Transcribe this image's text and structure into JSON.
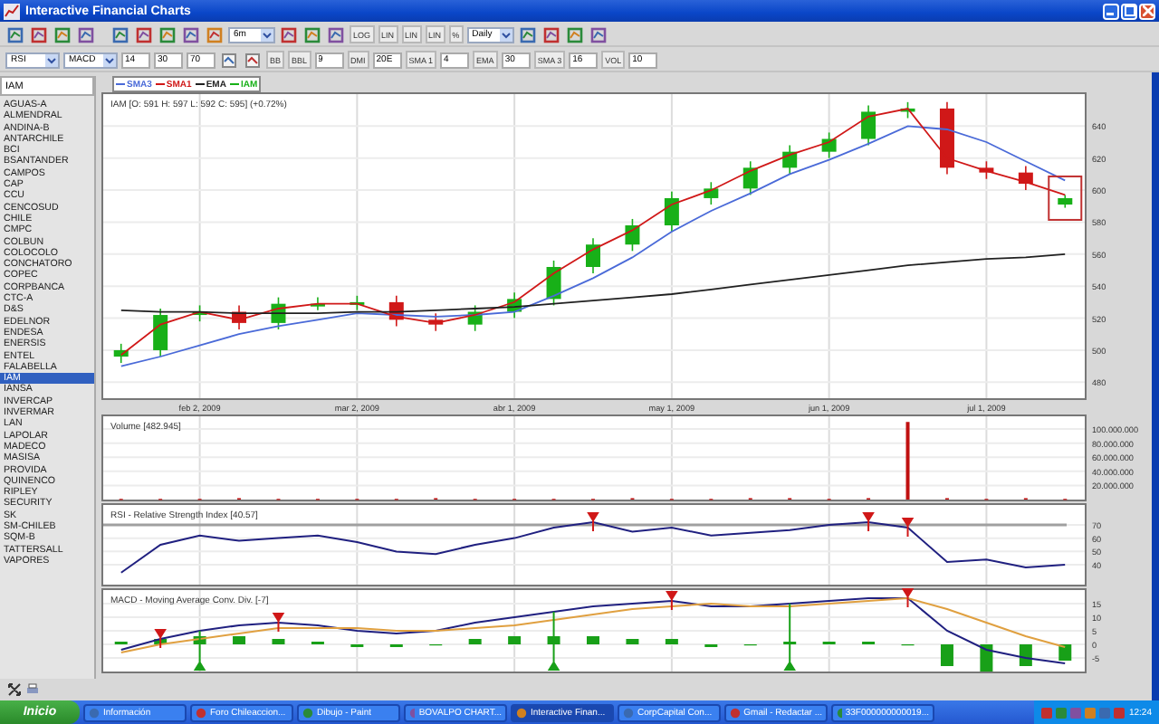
{
  "window": {
    "title": "Interactive Financial Charts"
  },
  "toolbar_1": [
    {
      "kind": "icon"
    },
    {
      "kind": "icon"
    },
    {
      "kind": "icon"
    },
    {
      "kind": "icon"
    },
    {
      "kind": "gap"
    },
    {
      "kind": "icon"
    },
    {
      "kind": "icon"
    },
    {
      "kind": "icon"
    },
    {
      "kind": "icon"
    },
    {
      "kind": "icon"
    },
    {
      "kind": "select",
      "value": "6m"
    },
    {
      "kind": "icon"
    },
    {
      "kind": "icon"
    },
    {
      "kind": "icon"
    },
    {
      "kind": "label",
      "text": "LOG"
    },
    {
      "kind": "label",
      "text": "LIN"
    },
    {
      "kind": "label",
      "text": "LIN"
    },
    {
      "kind": "label",
      "text": "LIN"
    },
    {
      "kind": "label",
      "text": "%"
    },
    {
      "kind": "select",
      "value": "Daily"
    },
    {
      "kind": "icon"
    },
    {
      "kind": "icon"
    },
    {
      "kind": "icon"
    },
    {
      "kind": "icon"
    }
  ],
  "toolbar_2": [
    {
      "kind": "select",
      "value": "RSI"
    },
    {
      "kind": "select",
      "value": "MACD"
    },
    {
      "kind": "field",
      "value": "14"
    },
    {
      "kind": "field",
      "value": "30"
    },
    {
      "kind": "field",
      "value": "70"
    },
    {
      "kind": "icon"
    },
    {
      "kind": "icon"
    },
    {
      "kind": "label",
      "text": "BB"
    },
    {
      "kind": "label",
      "text": "BBL"
    },
    {
      "kind": "field",
      "value": "9"
    },
    {
      "kind": "label",
      "text": "DMI"
    },
    {
      "kind": "field",
      "value": "20E"
    },
    {
      "kind": "label",
      "text": "SMA 1"
    },
    {
      "kind": "field",
      "value": "4"
    },
    {
      "kind": "label",
      "text": "EMA"
    },
    {
      "kind": "field",
      "value": "30"
    },
    {
      "kind": "label",
      "text": "SMA 3"
    },
    {
      "kind": "field",
      "value": "16"
    },
    {
      "kind": "label",
      "text": "VOL"
    },
    {
      "kind": "field",
      "value": "10"
    }
  ],
  "symbol_field": {
    "value": "IAM"
  },
  "symbols": [
    {
      "label": "AGUAS-A",
      "selected": false
    },
    {
      "label": "ALMENDRAL",
      "selected": false
    },
    {
      "label": "ANDINA-B",
      "selected": false
    },
    {
      "label": "ANTARCHILE",
      "selected": false
    },
    {
      "label": "BCI",
      "selected": false
    },
    {
      "label": "BSANTANDER",
      "selected": false
    },
    {
      "label": "CAMPOS",
      "selected": false
    },
    {
      "label": "CAP",
      "selected": false
    },
    {
      "label": "CCU",
      "selected": false
    },
    {
      "label": "CENCOSUD",
      "selected": false
    },
    {
      "label": "CHILE",
      "selected": false
    },
    {
      "label": "CMPC",
      "selected": false
    },
    {
      "label": "COLBUN",
      "selected": false
    },
    {
      "label": "COLOCOLO",
      "selected": false
    },
    {
      "label": "CONCHATORO",
      "selected": false
    },
    {
      "label": "COPEC",
      "selected": false
    },
    {
      "label": "CORPBANCA",
      "selected": false
    },
    {
      "label": "CTC-A",
      "selected": false
    },
    {
      "label": "D&S",
      "selected": false
    },
    {
      "label": "EDELNOR",
      "selected": false
    },
    {
      "label": "ENDESA",
      "selected": false
    },
    {
      "label": "ENERSIS",
      "selected": false
    },
    {
      "label": "ENTEL",
      "selected": false
    },
    {
      "label": "FALABELLA",
      "selected": false
    },
    {
      "label": "IAM",
      "selected": true
    },
    {
      "label": "IANSA",
      "selected": false
    },
    {
      "label": "INVERCAP",
      "selected": false
    },
    {
      "label": "INVERMAR",
      "selected": false
    },
    {
      "label": "LAN",
      "selected": false
    },
    {
      "label": "LAPOLAR",
      "selected": false
    },
    {
      "label": "MADECO",
      "selected": false
    },
    {
      "label": "MASISA",
      "selected": false
    },
    {
      "label": "PROVIDA",
      "selected": false
    },
    {
      "label": "QUINENCO",
      "selected": false
    },
    {
      "label": "RIPLEY",
      "selected": false
    },
    {
      "label": "SECURITY",
      "selected": false
    },
    {
      "label": "SK",
      "selected": false
    },
    {
      "label": "SM-CHILEB",
      "selected": false
    },
    {
      "label": "SQM-B",
      "selected": false
    },
    {
      "label": "TATTERSALL",
      "selected": false
    },
    {
      "label": "VAPORES",
      "selected": false
    }
  ],
  "charts": [
    {
      "chart_data": {
        "type": "candlestick",
        "title": "IAM [O: 591  H: 597  L: 592  C: 595] (+0.72%)",
        "grid": true,
        "categories": [
          null,
          null,
          "feb 2, 2009",
          null,
          null,
          null,
          "mar 2, 2009",
          null,
          null,
          null,
          "abr 1, 2009",
          null,
          null,
          null,
          "may 1, 2009",
          null,
          null,
          null,
          "jun 1, 2009",
          null,
          null,
          null,
          "jul 1, 2009",
          null,
          null
        ],
        "ylim": [
          470,
          660
        ],
        "yticks": [
          480,
          500,
          520,
          540,
          560,
          580,
          600,
          620,
          640
        ],
        "series": [
          {
            "name": "SMA3",
            "color": "#4a6ad8",
            "type": "line",
            "values": [
              490,
              496,
              503,
              510,
              515,
              519,
              523,
              522,
              521,
              522,
              524,
              534,
              545,
              558,
              574,
              587,
              598,
              610,
              619,
              629,
              640,
              638,
              630,
              618,
              606
            ]
          },
          {
            "name": "SMA1",
            "color": "#d01818",
            "type": "line",
            "values": [
              497,
              516,
              524,
              519,
              526,
              529,
              529,
              521,
              517,
              522,
              530,
              548,
              563,
              575,
              591,
              600,
              612,
              622,
              630,
              646,
              651,
              620,
              612,
              605,
              597
            ]
          },
          {
            "name": "EMA",
            "color": "#202020",
            "type": "line",
            "values": [
              525,
              524,
              524,
              523,
              523,
              523,
              524,
              524,
              525,
              526,
              527,
              529,
              531,
              533,
              535,
              538,
              541,
              544,
              547,
              550,
              553,
              555,
              557,
              558,
              560
            ]
          },
          {
            "name": "IAM",
            "type": "candlestick",
            "ohlc": [
              [
                496,
                504,
                492,
                500
              ],
              [
                500,
                526,
                496,
                522
              ],
              [
                522,
                528,
                518,
                524
              ],
              [
                524,
                528,
                513,
                517
              ],
              [
                517,
                533,
                513,
                529
              ],
              [
                529,
                533,
                525,
                529
              ],
              [
                529,
                534,
                525,
                530
              ],
              [
                530,
                534,
                515,
                519
              ],
              [
                519,
                523,
                512,
                516
              ],
              [
                516,
                528,
                512,
                524
              ],
              [
                524,
                536,
                520,
                532
              ],
              [
                532,
                556,
                528,
                552
              ],
              [
                552,
                570,
                548,
                566
              ],
              [
                566,
                582,
                562,
                578
              ],
              [
                578,
                599,
                574,
                595
              ],
              [
                595,
                605,
                591,
                601
              ],
              [
                601,
                618,
                597,
                614
              ],
              [
                614,
                628,
                610,
                624
              ],
              [
                624,
                636,
                620,
                632
              ],
              [
                632,
                653,
                628,
                649
              ],
              [
                649,
                655,
                645,
                651
              ],
              [
                651,
                655,
                610,
                614
              ],
              [
                614,
                618,
                607,
                611
              ],
              [
                611,
                615,
                600,
                604
              ],
              [
                591,
                597,
                589,
                595
              ]
            ]
          }
        ]
      }
    },
    {
      "chart_data": {
        "type": "bar",
        "title": "Volume [482.945]",
        "grid": true,
        "categories": [
          null,
          null,
          null,
          null,
          null,
          null,
          null,
          null,
          null,
          null,
          null,
          null,
          null,
          null,
          null,
          null,
          null,
          null,
          null,
          null,
          null,
          null,
          null,
          null,
          null
        ],
        "ylim": [
          0,
          118000000
        ],
        "yticks": [
          {
            "value": 20000000,
            "label": "20.000.000"
          },
          {
            "value": 40000000,
            "label": "40.000.000"
          },
          {
            "value": 60000000,
            "label": "60.000.000"
          },
          {
            "value": 80000000,
            "label": "80.000.000"
          },
          {
            "value": 100000000,
            "label": "100.000.000"
          }
        ],
        "series": [
          {
            "color": "#c01010",
            "type": "bar",
            "values": [
              1000000,
              1000000,
              1000000,
              2000000,
              1000000,
              1000000,
              1000000,
              1000000,
              2000000,
              1000000,
              1000000,
              1000000,
              1000000,
              2000000,
              1000000,
              1000000,
              2000000,
              2000000,
              1000000,
              2000000,
              110000000,
              2000000,
              1000000,
              2000000,
              1000000
            ]
          }
        ]
      }
    },
    {
      "chart_data": {
        "type": "line",
        "title": "RSI - Relative Strength Index [40.57]",
        "grid": true,
        "categories": [
          null,
          null,
          null,
          null,
          null,
          null,
          null,
          null,
          null,
          null,
          null,
          null,
          null,
          null,
          null,
          null,
          null,
          null,
          null,
          null,
          null,
          null,
          null,
          null,
          null
        ],
        "ylim": [
          25,
          85
        ],
        "yticks": [
          40,
          50,
          60,
          70
        ],
        "ref_lines": [
          {
            "axis": "y",
            "value": 70
          }
        ],
        "series": [
          {
            "color": "#202080",
            "type": "line",
            "values": [
              34,
              55,
              62,
              58,
              60,
              62,
              57,
              50,
              48,
              55,
              60,
              68,
              72,
              65,
              68,
              62,
              64,
              66,
              70,
              72,
              68,
              42,
              44,
              38,
              40
            ]
          }
        ]
      }
    },
    {
      "chart_data": {
        "type": "line",
        "title": "MACD - Moving Average Conv. Div. [-7]",
        "grid": true,
        "categories": [
          null,
          null,
          null,
          null,
          null,
          null,
          null,
          null,
          null,
          null,
          null,
          null,
          null,
          null,
          null,
          null,
          null,
          null,
          null,
          null,
          null,
          null,
          null,
          null,
          null
        ],
        "ylim": [
          -10,
          20
        ],
        "yticks": [
          -5,
          0,
          5,
          10,
          15
        ],
        "series": [
          {
            "color": "#18a018",
            "type": "bar",
            "values": [
              1,
              2,
              3,
              3,
              2,
              1,
              -1,
              -1,
              0,
              2,
              3,
              3,
              3,
              2,
              2,
              -1,
              0,
              1,
              1,
              1,
              0,
              -8,
              -10,
              -8,
              -6
            ]
          },
          {
            "color": "#202080",
            "type": "line",
            "values": [
              -2,
              2,
              5,
              7,
              8,
              7,
              5,
              4,
              5,
              8,
              10,
              12,
              14,
              15,
              16,
              14,
              14,
              15,
              16,
              17,
              17,
              5,
              -2,
              -5,
              -7
            ]
          },
          {
            "color": "#e0a040",
            "type": "line",
            "values": [
              -3,
              0,
              2,
              4,
              6,
              6,
              6,
              5,
              5,
              6,
              7,
              9,
              11,
              13,
              14,
              15,
              14,
              14,
              15,
              16,
              17,
              13,
              8,
              3,
              -1
            ]
          }
        ]
      }
    }
  ],
  "taskbar": {
    "start": "Inicio",
    "items": [
      {
        "label": "Información",
        "selected": false
      },
      {
        "label": "Foro Chileaccion...",
        "selected": false
      },
      {
        "label": "Dibujo - Paint",
        "selected": false
      },
      {
        "label": "BOVALPO CHART...",
        "selected": false
      },
      {
        "label": "Interactive Finan...",
        "selected": true
      },
      {
        "label": "CorpCapital Con...",
        "selected": false
      },
      {
        "label": "Gmail - Redactar ...",
        "selected": false
      },
      {
        "label": "33F000000000019...",
        "selected": false
      }
    ],
    "clock": "12:24"
  }
}
